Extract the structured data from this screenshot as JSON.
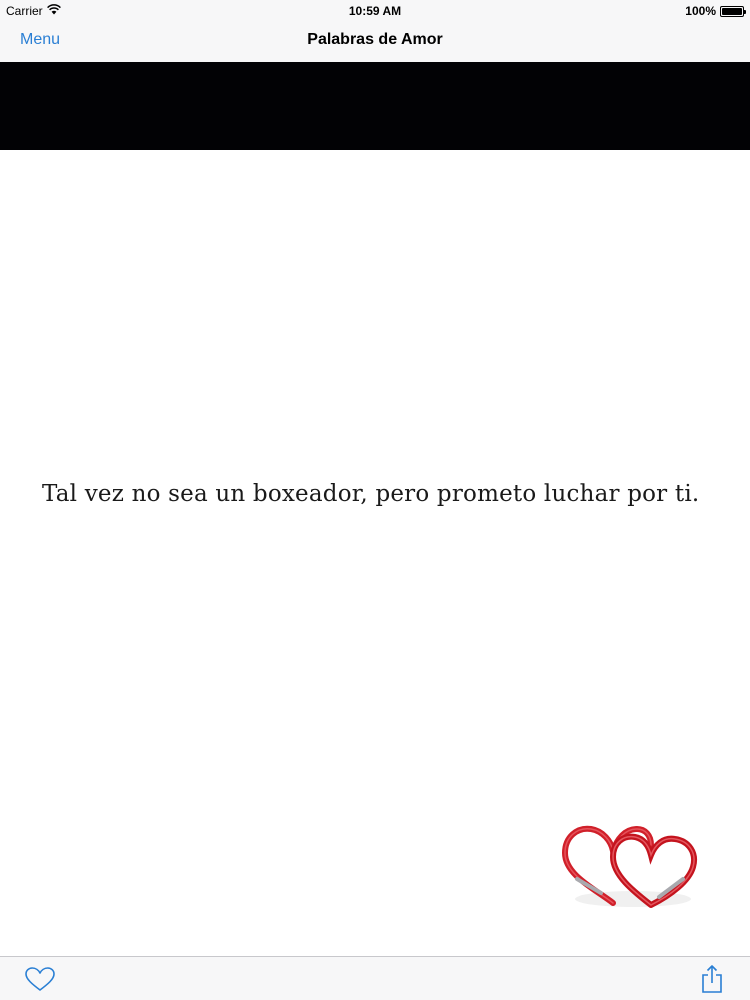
{
  "status_bar": {
    "carrier": "Carrier",
    "time": "10:59 AM",
    "battery": "100%",
    "battery_level": 1.0
  },
  "nav": {
    "menu_label": "Menu",
    "title": "Palabras de Amor"
  },
  "content": {
    "quote": "Tal vez no sea un boxeador, pero prometo luchar por ti."
  },
  "toolbar": {
    "favorite_icon": "heart-outline-icon",
    "share_icon": "share-icon"
  },
  "colors": {
    "accent": "#2a7fd4",
    "banner": "#020205",
    "hearts": "#d0202a"
  }
}
